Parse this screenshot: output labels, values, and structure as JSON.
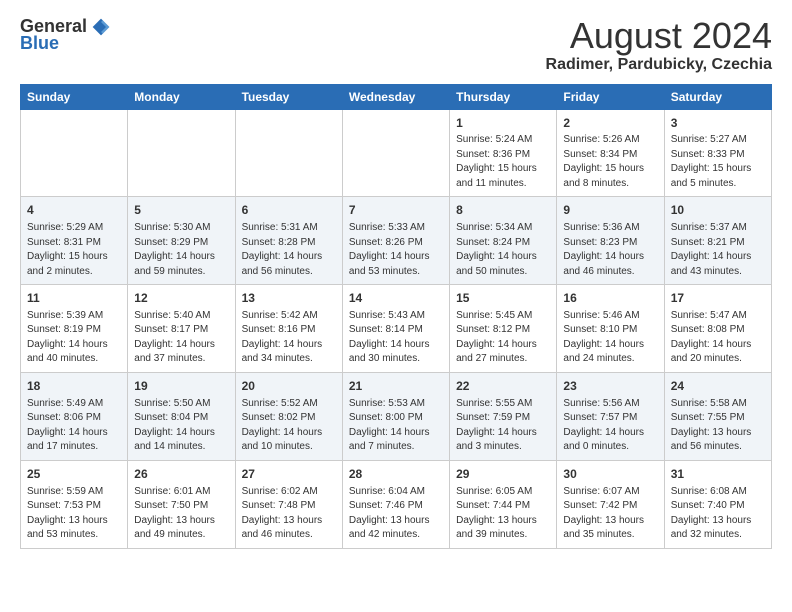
{
  "header": {
    "logo_general": "General",
    "logo_blue": "Blue",
    "calendar_title": "August 2024",
    "calendar_subtitle": "Radimer, Pardubicky, Czechia"
  },
  "weekdays": [
    "Sunday",
    "Monday",
    "Tuesday",
    "Wednesday",
    "Thursday",
    "Friday",
    "Saturday"
  ],
  "weeks": [
    [
      {
        "day": "",
        "info": ""
      },
      {
        "day": "",
        "info": ""
      },
      {
        "day": "",
        "info": ""
      },
      {
        "day": "",
        "info": ""
      },
      {
        "day": "1",
        "info": "Sunrise: 5:24 AM\nSunset: 8:36 PM\nDaylight: 15 hours\nand 11 minutes."
      },
      {
        "day": "2",
        "info": "Sunrise: 5:26 AM\nSunset: 8:34 PM\nDaylight: 15 hours\nand 8 minutes."
      },
      {
        "day": "3",
        "info": "Sunrise: 5:27 AM\nSunset: 8:33 PM\nDaylight: 15 hours\nand 5 minutes."
      }
    ],
    [
      {
        "day": "4",
        "info": "Sunrise: 5:29 AM\nSunset: 8:31 PM\nDaylight: 15 hours\nand 2 minutes."
      },
      {
        "day": "5",
        "info": "Sunrise: 5:30 AM\nSunset: 8:29 PM\nDaylight: 14 hours\nand 59 minutes."
      },
      {
        "day": "6",
        "info": "Sunrise: 5:31 AM\nSunset: 8:28 PM\nDaylight: 14 hours\nand 56 minutes."
      },
      {
        "day": "7",
        "info": "Sunrise: 5:33 AM\nSunset: 8:26 PM\nDaylight: 14 hours\nand 53 minutes."
      },
      {
        "day": "8",
        "info": "Sunrise: 5:34 AM\nSunset: 8:24 PM\nDaylight: 14 hours\nand 50 minutes."
      },
      {
        "day": "9",
        "info": "Sunrise: 5:36 AM\nSunset: 8:23 PM\nDaylight: 14 hours\nand 46 minutes."
      },
      {
        "day": "10",
        "info": "Sunrise: 5:37 AM\nSunset: 8:21 PM\nDaylight: 14 hours\nand 43 minutes."
      }
    ],
    [
      {
        "day": "11",
        "info": "Sunrise: 5:39 AM\nSunset: 8:19 PM\nDaylight: 14 hours\nand 40 minutes."
      },
      {
        "day": "12",
        "info": "Sunrise: 5:40 AM\nSunset: 8:17 PM\nDaylight: 14 hours\nand 37 minutes."
      },
      {
        "day": "13",
        "info": "Sunrise: 5:42 AM\nSunset: 8:16 PM\nDaylight: 14 hours\nand 34 minutes."
      },
      {
        "day": "14",
        "info": "Sunrise: 5:43 AM\nSunset: 8:14 PM\nDaylight: 14 hours\nand 30 minutes."
      },
      {
        "day": "15",
        "info": "Sunrise: 5:45 AM\nSunset: 8:12 PM\nDaylight: 14 hours\nand 27 minutes."
      },
      {
        "day": "16",
        "info": "Sunrise: 5:46 AM\nSunset: 8:10 PM\nDaylight: 14 hours\nand 24 minutes."
      },
      {
        "day": "17",
        "info": "Sunrise: 5:47 AM\nSunset: 8:08 PM\nDaylight: 14 hours\nand 20 minutes."
      }
    ],
    [
      {
        "day": "18",
        "info": "Sunrise: 5:49 AM\nSunset: 8:06 PM\nDaylight: 14 hours\nand 17 minutes."
      },
      {
        "day": "19",
        "info": "Sunrise: 5:50 AM\nSunset: 8:04 PM\nDaylight: 14 hours\nand 14 minutes."
      },
      {
        "day": "20",
        "info": "Sunrise: 5:52 AM\nSunset: 8:02 PM\nDaylight: 14 hours\nand 10 minutes."
      },
      {
        "day": "21",
        "info": "Sunrise: 5:53 AM\nSunset: 8:00 PM\nDaylight: 14 hours\nand 7 minutes."
      },
      {
        "day": "22",
        "info": "Sunrise: 5:55 AM\nSunset: 7:59 PM\nDaylight: 14 hours\nand 3 minutes."
      },
      {
        "day": "23",
        "info": "Sunrise: 5:56 AM\nSunset: 7:57 PM\nDaylight: 14 hours\nand 0 minutes."
      },
      {
        "day": "24",
        "info": "Sunrise: 5:58 AM\nSunset: 7:55 PM\nDaylight: 13 hours\nand 56 minutes."
      }
    ],
    [
      {
        "day": "25",
        "info": "Sunrise: 5:59 AM\nSunset: 7:53 PM\nDaylight: 13 hours\nand 53 minutes."
      },
      {
        "day": "26",
        "info": "Sunrise: 6:01 AM\nSunset: 7:50 PM\nDaylight: 13 hours\nand 49 minutes."
      },
      {
        "day": "27",
        "info": "Sunrise: 6:02 AM\nSunset: 7:48 PM\nDaylight: 13 hours\nand 46 minutes."
      },
      {
        "day": "28",
        "info": "Sunrise: 6:04 AM\nSunset: 7:46 PM\nDaylight: 13 hours\nand 42 minutes."
      },
      {
        "day": "29",
        "info": "Sunrise: 6:05 AM\nSunset: 7:44 PM\nDaylight: 13 hours\nand 39 minutes."
      },
      {
        "day": "30",
        "info": "Sunrise: 6:07 AM\nSunset: 7:42 PM\nDaylight: 13 hours\nand 35 minutes."
      },
      {
        "day": "31",
        "info": "Sunrise: 6:08 AM\nSunset: 7:40 PM\nDaylight: 13 hours\nand 32 minutes."
      }
    ]
  ]
}
